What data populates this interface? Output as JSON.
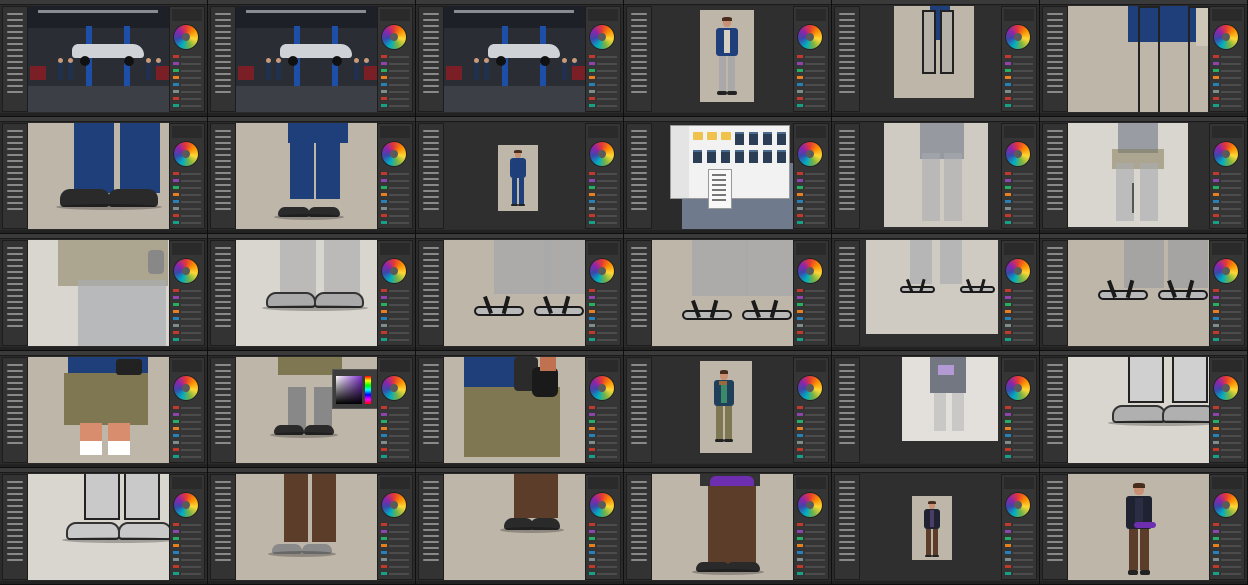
{
  "window": {
    "layout": "contact-sheet",
    "columns": 6,
    "rows": 5,
    "app_type": "digital-painting-application"
  },
  "colors": {
    "ui_background": "#2b2b2b",
    "panel": "#353535",
    "canvas_beige": "#bfb6aa",
    "canvas_light": "#d9d5cf",
    "jeans_blue": "#1f3f7a",
    "khaki": "#7f7752",
    "grey_pants": "#a9a9a9",
    "brown_pants": "#5b3d2a",
    "shoe_black": "#2a2a2a"
  },
  "frames": [
    {
      "id": 1,
      "subject": "garage-scene",
      "icon": "garage-scene-thumbnail"
    },
    {
      "id": 2,
      "subject": "garage-scene",
      "icon": "garage-scene-thumbnail"
    },
    {
      "id": 3,
      "subject": "garage-scene",
      "icon": "garage-scene-thumbnail"
    },
    {
      "id": 4,
      "subject": "character-blue-jacket-full",
      "icon": "character-figure"
    },
    {
      "id": 5,
      "subject": "blue-jacket-legs-sketch",
      "icon": "legs-sketch"
    },
    {
      "id": 6,
      "subject": "blue-jacket-legs-closeup",
      "icon": "legs-closeup"
    },
    {
      "id": 7,
      "subject": "jeans-and-black-shoes",
      "icon": "shoes-closeup"
    },
    {
      "id": 8,
      "subject": "jeans-and-black-shoes",
      "icon": "shoes-closeup"
    },
    {
      "id": 9,
      "subject": "character-blue-small",
      "icon": "character-figure"
    },
    {
      "id": 10,
      "subject": "file-open-dialog",
      "icon": "file-dialog"
    },
    {
      "id": 11,
      "subject": "grey-legs-sketch",
      "icon": "legs-sketch"
    },
    {
      "id": 12,
      "subject": "grey-legs-sketch",
      "icon": "legs-sketch"
    },
    {
      "id": 13,
      "subject": "cargo-shorts-sketch",
      "icon": "shorts-sketch"
    },
    {
      "id": 14,
      "subject": "sandals-sketch",
      "icon": "sandals-sketch"
    },
    {
      "id": 15,
      "subject": "sandals-lineart",
      "icon": "sandals-lineart"
    },
    {
      "id": 16,
      "subject": "sandals-lineart",
      "icon": "sandals-lineart"
    },
    {
      "id": 17,
      "subject": "grey-legs-sandals",
      "icon": "legs-sketch"
    },
    {
      "id": 18,
      "subject": "sandals-black-lines",
      "icon": "sandals-lineart"
    },
    {
      "id": 19,
      "subject": "khaki-shorts-colored",
      "icon": "shorts-colored"
    },
    {
      "id": 20,
      "subject": "khaki-shorts-with-color-picker",
      "icon": "color-picker"
    },
    {
      "id": 21,
      "subject": "khaki-shorts-glove",
      "icon": "glove-closeup"
    },
    {
      "id": 22,
      "subject": "character-khaki-full",
      "icon": "character-figure"
    },
    {
      "id": 23,
      "subject": "grey-character-sketch",
      "icon": "character-figure"
    },
    {
      "id": 24,
      "subject": "grey-shoes-sketch",
      "icon": "shoes-sketch"
    },
    {
      "id": 25,
      "subject": "grey-shoes-sketch",
      "icon": "shoes-sketch"
    },
    {
      "id": 26,
      "subject": "brown-pants",
      "icon": "pants-colored"
    },
    {
      "id": 27,
      "subject": "brown-pants-black-shoes",
      "icon": "pants-colored"
    },
    {
      "id": 28,
      "subject": "brown-pants-fanny-pack",
      "icon": "pants-colored"
    },
    {
      "id": 29,
      "subject": "character-brown-small",
      "icon": "character-figure"
    },
    {
      "id": 30,
      "subject": "character-brown-full",
      "icon": "character-figure"
    }
  ]
}
